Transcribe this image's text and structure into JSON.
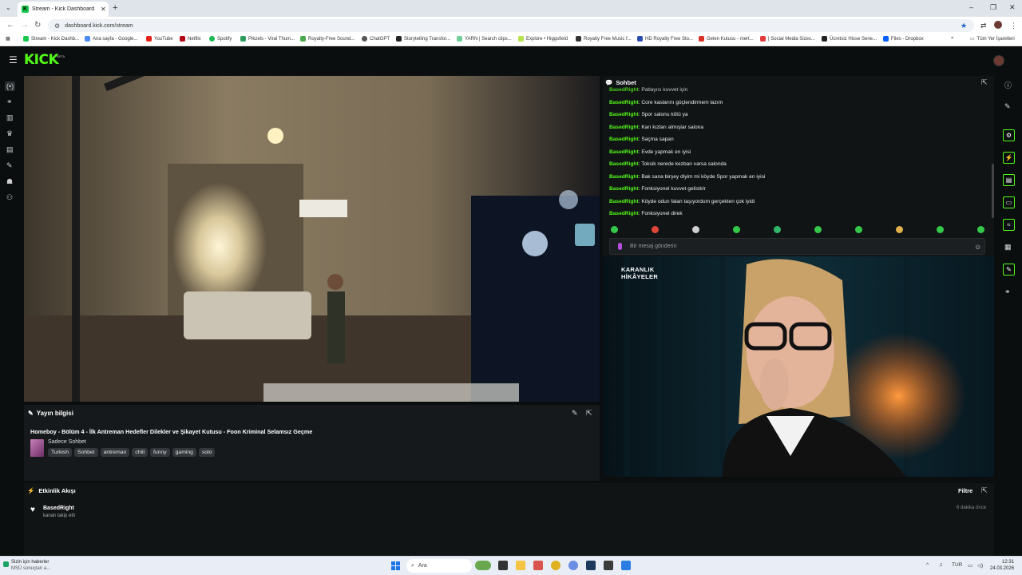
{
  "browser": {
    "tab_title": "Stream - Kick Dashboard",
    "url": "dashboard.kick.com/stream",
    "bookmarks": [
      "Stream - Kick Dashb...",
      "Ana sayfa - Google...",
      "YouTube",
      "Netflix",
      "Spotify",
      "Pikzels - Viral Thum...",
      "Royalty-Free Sound...",
      "ChatGPT",
      "Storytelling Transfor...",
      "YARN | Search clips...",
      "Explore • Higgsfield",
      "Royalty Free Music f...",
      "HD Royalty Free Sto...",
      "Gelen Kutusu - mert...",
      "| Social Media Sizes...",
      "Ücretsiz Hisse Sene...",
      "Files - Dropbox"
    ],
    "bookmarks_more": "»",
    "all_bookmarks": "Tüm Yer İşaretleri"
  },
  "kick": {
    "logo": "KICK",
    "beta": "BETA"
  },
  "stream_info": {
    "header": "Yayın bilgisi",
    "title": "Homeboy - Bölüm 4 - İlk Antreman Hedefler Dilekler ve Şikayet Kutusu - Foon Kriminal Selamsız Geçme",
    "category": "Sadece Sohbet",
    "tags": [
      "Turkish",
      "Sohbet",
      "antreman",
      "chill",
      "funny",
      "gaming",
      "solo"
    ]
  },
  "chat": {
    "header": "Sohbet",
    "messages": [
      {
        "user": "BasedRight",
        "text": "Patlayıcı kuvvet için"
      },
      {
        "user": "BasedRight",
        "text": "Core kaslarını güçlendirmem lazım"
      },
      {
        "user": "BasedRight",
        "text": "Spor salonu kötü ya"
      },
      {
        "user": "BasedRight",
        "text": "Karı kızları almışlar salona"
      },
      {
        "user": "BasedRight",
        "text": "Saçma sapan"
      },
      {
        "user": "BasedRight",
        "text": "Evde yapmak en iyisi"
      },
      {
        "user": "BasedRight",
        "text": "Toksik nerede kezban varsa salonda"
      },
      {
        "user": "BasedRight",
        "text": "Bak sana birşey diyim mi köyde Spor yapmak en iyisi"
      },
      {
        "user": "BasedRight",
        "text": "Fonksiyonel kuvvet gelistirir"
      },
      {
        "user": "BasedRight",
        "text": "Köyde odun falan taşıyordum gerçekten çok iyidi"
      },
      {
        "user": "BasedRight",
        "text": "Fonksiyonel direk"
      }
    ],
    "separator": ": ",
    "input_placeholder": "Bir mesaj gönderin",
    "emote_colors": [
      "#34c94a",
      "#e0453a",
      "#cfcfcf",
      "#34c94a",
      "#2fb86a",
      "#34c94a",
      "#34c94a",
      "#e0b14a",
      "#34c94a",
      "#34c94a"
    ]
  },
  "guest_cam": {
    "overlay_line1": "KARANLIK",
    "overlay_line2": "HİKÂYELER"
  },
  "activity": {
    "header": "Etkinlik Akışı",
    "filter": "Filtre",
    "items": [
      {
        "user": "BasedRight",
        "desc": "kanalı takip etti",
        "time": "6 dakika önce"
      }
    ]
  },
  "taskbar": {
    "news_line1": "Sizin için haberler",
    "news_line2": "MSÜ sonuçları a...",
    "search": "Ara",
    "lang": "TUR",
    "time": "12:31",
    "date": "24.03.2026"
  },
  "colors": {
    "kick_green": "#53fc18",
    "bg": "#0b0e0f",
    "panel": "#16191b"
  }
}
